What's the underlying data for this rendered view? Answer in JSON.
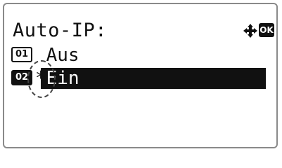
{
  "screen": {
    "title": "Auto-IP:",
    "nav_icon": "four-way-arrow-icon",
    "ok_label": "OK"
  },
  "options": [
    {
      "number": "01",
      "marker": "",
      "label": "Aus",
      "selected": false
    },
    {
      "number": "02",
      "marker": "*",
      "label": "Ein",
      "selected": true
    }
  ],
  "colors": {
    "text": "#111111",
    "background": "#ffffff",
    "highlight": "#111111",
    "border": "#8a8a8a"
  }
}
